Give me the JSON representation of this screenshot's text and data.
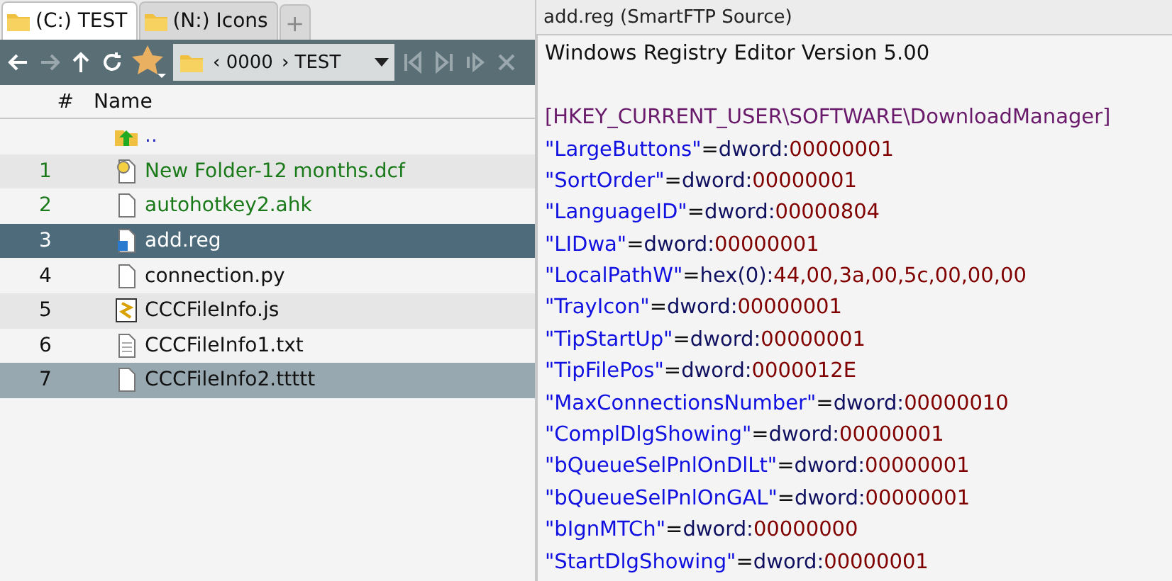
{
  "tabs": [
    {
      "label": "(C:) TEST",
      "selected": true
    },
    {
      "label": "(N:) Icons",
      "selected": false
    }
  ],
  "new_tab": "+",
  "breadcrumb": [
    {
      "arrow": "‹",
      "label": "0000"
    },
    {
      "arrow": "›",
      "label": "TEST"
    }
  ],
  "file_list": {
    "columns": [
      "#",
      "Name"
    ],
    "rows": [
      {
        "number": "",
        "name": "..",
        "kind": "parent",
        "color": "#3030c0",
        "selected": false,
        "hovered": false
      },
      {
        "number": "1",
        "name": "New Folder-12 months.dcf",
        "kind": "link",
        "color": "#1a7a1a",
        "selected": false,
        "hovered": false
      },
      {
        "number": "2",
        "name": "autohotkey2.ahk",
        "kind": "file",
        "color": "#1a7a1a",
        "selected": false,
        "hovered": false
      },
      {
        "number": "3",
        "name": "add.reg",
        "kind": "reg",
        "color": "#ffffff",
        "selected": true,
        "hovered": false
      },
      {
        "number": "4",
        "name": "connection.py",
        "kind": "file",
        "color": "#111111",
        "selected": false,
        "hovered": false
      },
      {
        "number": "5",
        "name": "CCCFileInfo.js",
        "kind": "script",
        "color": "#111111",
        "selected": false,
        "hovered": false
      },
      {
        "number": "6",
        "name": "CCCFileInfo1.txt",
        "kind": "text",
        "color": "#111111",
        "selected": false,
        "hovered": false
      },
      {
        "number": "7",
        "name": "CCCFileInfo2.ttttt",
        "kind": "file",
        "color": "#111111",
        "selected": false,
        "hovered": true
      }
    ]
  },
  "preview": {
    "title": "add.reg (SmartFTP Source)",
    "lines": [
      {
        "kind": "header",
        "text": "Windows Registry Editor Version 5.00"
      },
      {
        "kind": "blank"
      },
      {
        "kind": "section",
        "text": "[HKEY_CURRENT_USER\\SOFTWARE\\DownloadManager]"
      },
      {
        "kind": "entry",
        "key": "\"LargeButtons\"",
        "sep": "=",
        "type": "dword:",
        "value": "00000001"
      },
      {
        "kind": "entry",
        "key": "\"SortOrder\"",
        "sep": "=",
        "type": "dword:",
        "value": "00000001"
      },
      {
        "kind": "entry",
        "key": "\"LanguageID\"",
        "sep": "=",
        "type": "dword:",
        "value": "00000804"
      },
      {
        "kind": "entry",
        "key": "\"LIDwa\"",
        "sep": "=",
        "type": "dword:",
        "value": "00000001"
      },
      {
        "kind": "entry",
        "key": "\"LocalPathW\"",
        "sep": "=",
        "type": "hex(0):",
        "value": "44,00,3a,00,5c,00,00,00"
      },
      {
        "kind": "entry",
        "key": "\"TrayIcon\"",
        "sep": "=",
        "type": "dword:",
        "value": "00000001"
      },
      {
        "kind": "entry",
        "key": "\"TipStartUp\"",
        "sep": "=",
        "type": "dword:",
        "value": "00000001"
      },
      {
        "kind": "entry",
        "key": "\"TipFilePos\"",
        "sep": "=",
        "type": "dword:",
        "value": "0000012E"
      },
      {
        "kind": "entry",
        "key": "\"MaxConnectionsNumber\"",
        "sep": "=",
        "type": "dword:",
        "value": "00000010"
      },
      {
        "kind": "entry",
        "key": "\"ComplDlgShowing\"",
        "sep": "=",
        "type": "dword:",
        "value": "00000001"
      },
      {
        "kind": "entry",
        "key": "\"bQueueSelPnlOnDlLt\"",
        "sep": "=",
        "type": "dword:",
        "value": "00000001"
      },
      {
        "kind": "entry",
        "key": "\"bQueueSelPnlOnGAL\"",
        "sep": "=",
        "type": "dword:",
        "value": "00000001"
      },
      {
        "kind": "entry",
        "key": "\"bIgnMTCh\"",
        "sep": "=",
        "type": "dword:",
        "value": "00000000"
      },
      {
        "kind": "entry",
        "key": "\"StartDlgShowing\"",
        "sep": "=",
        "type": "dword:",
        "value": "00000001"
      }
    ]
  }
}
